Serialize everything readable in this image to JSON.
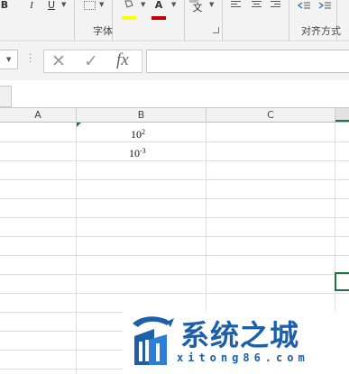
{
  "ribbon": {
    "font_group": {
      "label": "字体",
      "bold": "B",
      "italic": "I",
      "underline": "U",
      "font_color_letter": "A"
    },
    "phonetic_glyph": "文",
    "alignment_group": {
      "label": "对齐方式"
    }
  },
  "formula_bar": {
    "cancel_symbol": "✕",
    "enter_symbol": "✓",
    "fx_label": "fx",
    "value": ""
  },
  "sheet": {
    "columns": [
      "A",
      "B",
      "C"
    ],
    "cells": {
      "B1": {
        "base": "10",
        "exponent": "2"
      },
      "B2": {
        "base": "10",
        "exponent": "-3"
      }
    }
  },
  "watermark": {
    "title": "系统之城",
    "url": "xitong86.com"
  },
  "colors": {
    "font_color_accent": "#c00000",
    "highlight_accent": "#ffff00",
    "selection_border": "#217346",
    "watermark_blue": "#1d5fa8"
  }
}
